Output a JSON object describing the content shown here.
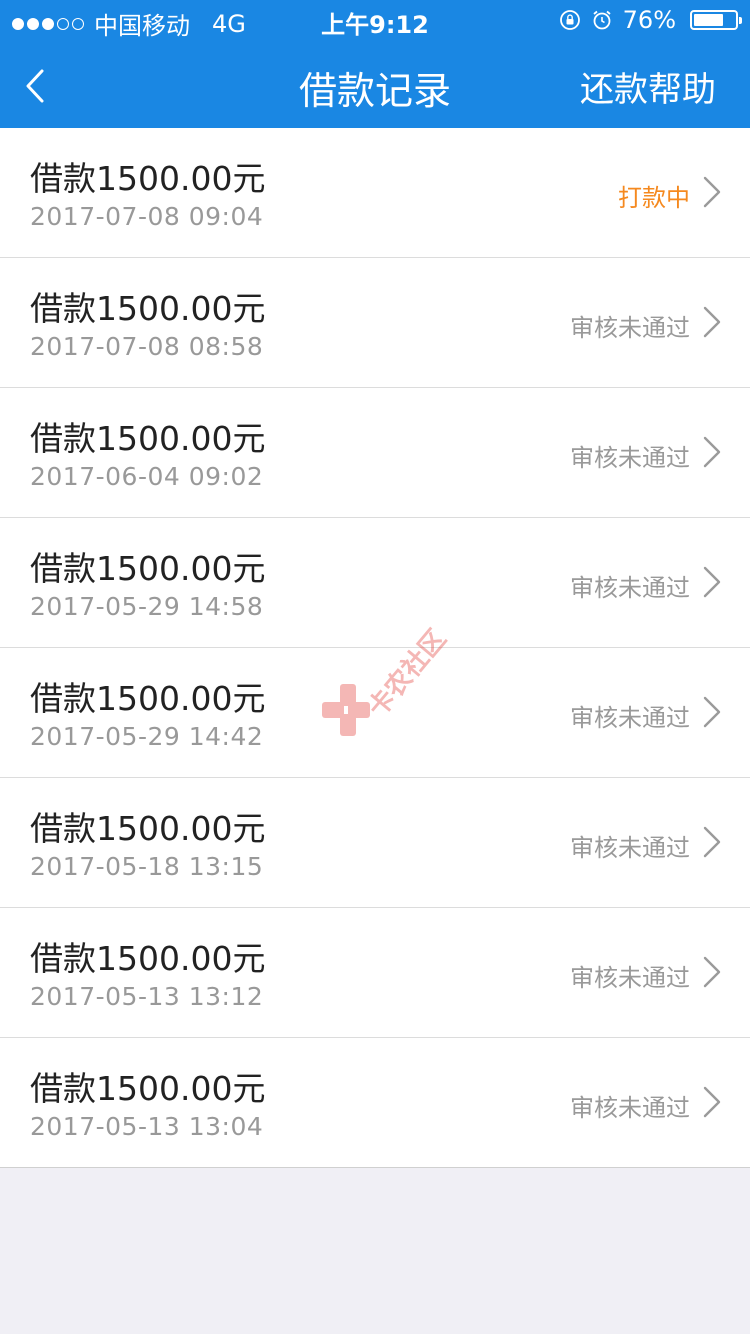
{
  "status_bar": {
    "carrier": "中国移动",
    "network": "4G",
    "time": "上午9:12",
    "battery_text": "76%",
    "battery_level": 0.76
  },
  "nav": {
    "title": "借款记录",
    "help_label": "还款帮助"
  },
  "records": [
    {
      "amount": "借款1500.00元",
      "date": "2017-07-08 09:04",
      "status": "打款中",
      "pending": true
    },
    {
      "amount": "借款1500.00元",
      "date": "2017-07-08 08:58",
      "status": "审核未通过",
      "pending": false
    },
    {
      "amount": "借款1500.00元",
      "date": "2017-06-04 09:02",
      "status": "审核未通过",
      "pending": false
    },
    {
      "amount": "借款1500.00元",
      "date": "2017-05-29 14:58",
      "status": "审核未通过",
      "pending": false
    },
    {
      "amount": "借款1500.00元",
      "date": "2017-05-29 14:42",
      "status": "审核未通过",
      "pending": false
    },
    {
      "amount": "借款1500.00元",
      "date": "2017-05-18 13:15",
      "status": "审核未通过",
      "pending": false
    },
    {
      "amount": "借款1500.00元",
      "date": "2017-05-13 13:12",
      "status": "审核未通过",
      "pending": false
    },
    {
      "amount": "借款1500.00元",
      "date": "2017-05-13 13:04",
      "status": "审核未通过",
      "pending": false
    }
  ],
  "watermark": {
    "text": "卡农社区"
  },
  "colors": {
    "primary": "#1a87e3",
    "pending_status": "#f5891f",
    "rejected_status": "#999999"
  },
  "icons": [
    "signal-dots-icon",
    "lock-rotation-icon",
    "alarm-icon",
    "battery-icon",
    "back-chevron-icon",
    "chevron-right-icon"
  ]
}
